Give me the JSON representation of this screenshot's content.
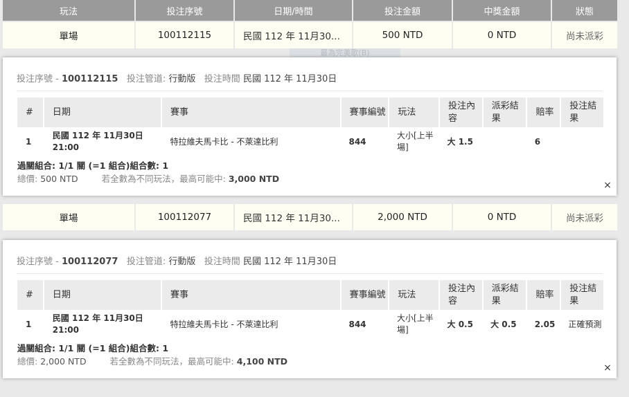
{
  "headers": [
    "玩法",
    "投注序號",
    "日期/時間",
    "投注金額",
    "中獎金額",
    "狀態"
  ],
  "ghost_text": "最為完美歌(B)",
  "info_labels": {
    "serial": "投注序號",
    "dash": "-",
    "channel": "投注管道:",
    "time": "投注時間"
  },
  "detail_headers": {
    "no": "#",
    "date": "日期",
    "event": "賽事",
    "event_no": "賽事編號",
    "play": "玩法",
    "bet_content": "投注內容",
    "payout_result": "派彩結果",
    "odds": "賠率",
    "bet_result": "投注結果"
  },
  "combo_label": "過關組合: 1/1 關 (=1 組合)組合數: 1",
  "total_label": "總價:",
  "max_win_label": "若全數為不同玩法，最高可能中:",
  "bets": [
    {
      "row": {
        "play": "單場",
        "serial": "100112115",
        "time": "民國 112 年 11月30...",
        "amount": "500 NTD",
        "win": "0 NTD",
        "status": "尚未派彩"
      },
      "detail": {
        "serial": "100112115",
        "channel": "行動版",
        "time": "民國 112 年 11月30日",
        "line": {
          "no": "1",
          "date": "民國 112 年 11月30日",
          "hour": "21:00",
          "event": "特拉維夫馬卡比 - 不萊達比利",
          "event_no": "844",
          "play": "大小[上半場]",
          "bet_content": "大 1.5",
          "payout_result": "",
          "odds": "6",
          "bet_result": ""
        },
        "total": "500 NTD",
        "max_win": "3,000 NTD"
      }
    },
    {
      "row": {
        "play": "單場",
        "serial": "100112077",
        "time": "民國 112 年 11月30...",
        "amount": "2,000 NTD",
        "win": "0 NTD",
        "status": "尚未派彩"
      },
      "detail": {
        "serial": "100112077",
        "channel": "行動版",
        "time": "民國 112 年 11月30日",
        "line": {
          "no": "1",
          "date": "民國 112 年 11月30日",
          "hour": "21:00",
          "event": "特拉維夫馬卡比 - 不萊達比利",
          "event_no": "844",
          "play": "大小[上半場]",
          "bet_content": "大 0.5",
          "payout_result": "大 0.5",
          "odds": "2.05",
          "bet_result": "正確預測"
        },
        "total": "2,000 NTD",
        "max_win": "4,100 NTD"
      }
    }
  ],
  "close_glyph": "×"
}
